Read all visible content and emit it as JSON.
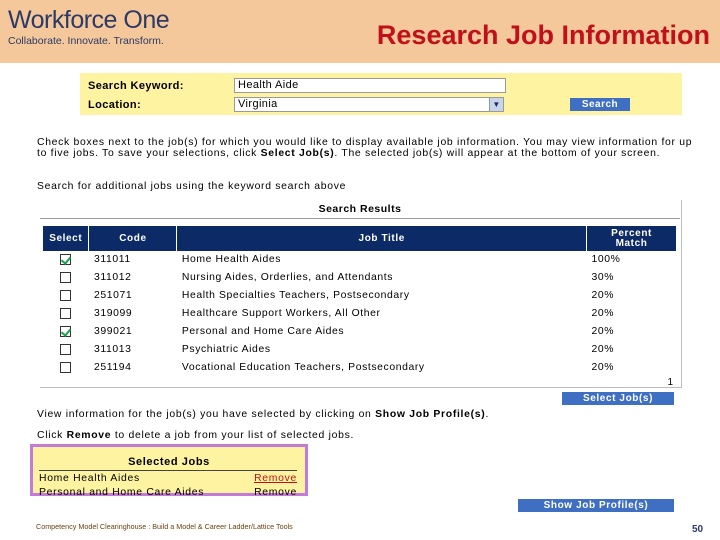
{
  "header": {
    "logo_name": "Workforce One",
    "logo_tagline": "Collaborate. Innovate. Transform.",
    "title": "Research Job Information"
  },
  "search": {
    "keyword_label": "Search Keyword:",
    "keyword_value": "Health Aide",
    "location_label": "Location:",
    "location_value": "Virginia",
    "search_button": "Search"
  },
  "instructions": {
    "line1a": "Check boxes next to the job(s) for which you would like to display available job information. You may view information for up to five jobs. To save your selections, click ",
    "line1_bold": "Select Job(s)",
    "line1b": ". The selected job(s) will appear at the bottom of your screen.",
    "line2": "Search for additional jobs using the keyword search above"
  },
  "results": {
    "title": "Search Results",
    "columns": [
      "Select",
      "Code",
      "Job Title",
      "Percent Match"
    ],
    "rows": [
      {
        "checked": true,
        "code": "311011",
        "title": "Home Health Aides",
        "match": "100%"
      },
      {
        "checked": false,
        "code": "311012",
        "title": "Nursing Aides, Orderlies, and Attendants",
        "match": "30%"
      },
      {
        "checked": false,
        "code": "251071",
        "title": "Health Specialties Teachers, Postsecondary",
        "match": "20%"
      },
      {
        "checked": false,
        "code": "319099",
        "title": "Healthcare Support Workers, All Other",
        "match": "20%"
      },
      {
        "checked": true,
        "code": "399021",
        "title": "Personal and Home Care Aides",
        "match": "20%"
      },
      {
        "checked": false,
        "code": "311013",
        "title": "Psychiatric Aides",
        "match": "20%"
      },
      {
        "checked": false,
        "code": "251194",
        "title": "Vocational Education Teachers, Postsecondary",
        "match": "20%"
      }
    ],
    "page_number": "1",
    "select_button": "Select Job(s)"
  },
  "view_instruction": {
    "prefix": "View information for the job(s) you have selected by clicking on ",
    "bold": "Show Job Profile(s)",
    "suffix": "."
  },
  "remove_instruction": {
    "prefix": "Click ",
    "bold": "Remove",
    "suffix": " to delete a job from your list of selected jobs."
  },
  "selected_jobs": {
    "title": "Selected Jobs",
    "items": [
      {
        "title": "Home Health Aides",
        "action": "Remove"
      },
      {
        "title": "Personal and Home Care Aides",
        "action": "Remove"
      }
    ]
  },
  "show_profile_button": "Show Job Profile(s)",
  "footer": {
    "note": "Competency Model Clearinghouse : Build a Model & Career Ladder/Lattice Tools",
    "slide_number": "50"
  },
  "colors": {
    "header_bg": "#f4c89a",
    "title_red": "#c0111b",
    "table_header": "#0c2a66",
    "button_blue": "#3f6fc3",
    "panel_yellow": "#fdf3a0",
    "selected_border": "#c37ad8"
  }
}
